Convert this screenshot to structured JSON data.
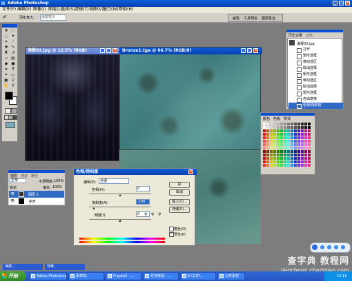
{
  "app": {
    "title": "Adobe Photoshop"
  },
  "menubar": {
    "items": [
      "文件(F)",
      "编辑(E)",
      "图像(I)",
      "图层(L)",
      "选择(S)",
      "滤镜(T)",
      "视图(V)",
      "窗口(W)",
      "帮助(H)"
    ]
  },
  "options_bar": {
    "label": "羽化宽大:",
    "value": "画笔笔尖"
  },
  "dock_tabs": [
    "画笔",
    "工具预设",
    "图层复合"
  ],
  "documents": [
    {
      "title": "海报02.jpg @ 12.5% (RGB)"
    },
    {
      "title": "Bronze1.tga @ 66.7% (RGB/8)"
    }
  ],
  "history": {
    "tabs": [
      "历史记录",
      "动作"
    ],
    "snapshot": "海报03.jpg",
    "items": [
      "打开",
      "矩形选框",
      "移动选区",
      "取消选择",
      "矩形选框",
      "移动选区",
      "取消选择",
      "矩形选框",
      "自由变换",
      "色相/饱和度"
    ],
    "active_index": 9
  },
  "swatches": {
    "tabs": [
      "颜色",
      "色板",
      "样式"
    ]
  },
  "layers": {
    "tabs": [
      "图层",
      "通道",
      "路径"
    ],
    "mode": "正常",
    "opacity_label": "不透明度:",
    "opacity": "100%",
    "lock_label": "锁定:",
    "fill_label": "填充:",
    "fill": "100%",
    "rows": [
      {
        "name": "图层 1",
        "active": true
      },
      {
        "name": "背景",
        "active": false
      }
    ]
  },
  "hue_dialog": {
    "title": "色相/饱和度",
    "edit_label": "编辑(E):",
    "edit_value": "全图",
    "hue_label": "色相(H):",
    "hue_value": "0",
    "sat_label": "饱和度(A):",
    "sat_value": "-100",
    "light_label": "明度(I):",
    "light_value": "0",
    "ok": "好",
    "cancel": "取消",
    "load": "载入(L)...",
    "save": "存储(S)...",
    "colorize": "着色(O)",
    "preview": "预览(P)",
    "hue_level": 0.5,
    "sat_level": 0.08,
    "light_level": 0.5
  },
  "taskbar": {
    "start": "开始",
    "tasks": [
      "Adobe Photoshop",
      "素材01",
      "Frigate2 - ...",
      "任务资源 - ...",
      "E:\\工作\\..",
      "公共素材"
    ],
    "time": "15:11"
  },
  "minimized": [
    "海报...",
    "背景..."
  ],
  "watermark": {
    "line1": "查字典 教程网",
    "line2": "jiaocheng.chazidian.com"
  },
  "colors": {
    "titlebar": "#0a4fd0",
    "accent": "#316ac5",
    "workspace": "#7d7d7d"
  }
}
